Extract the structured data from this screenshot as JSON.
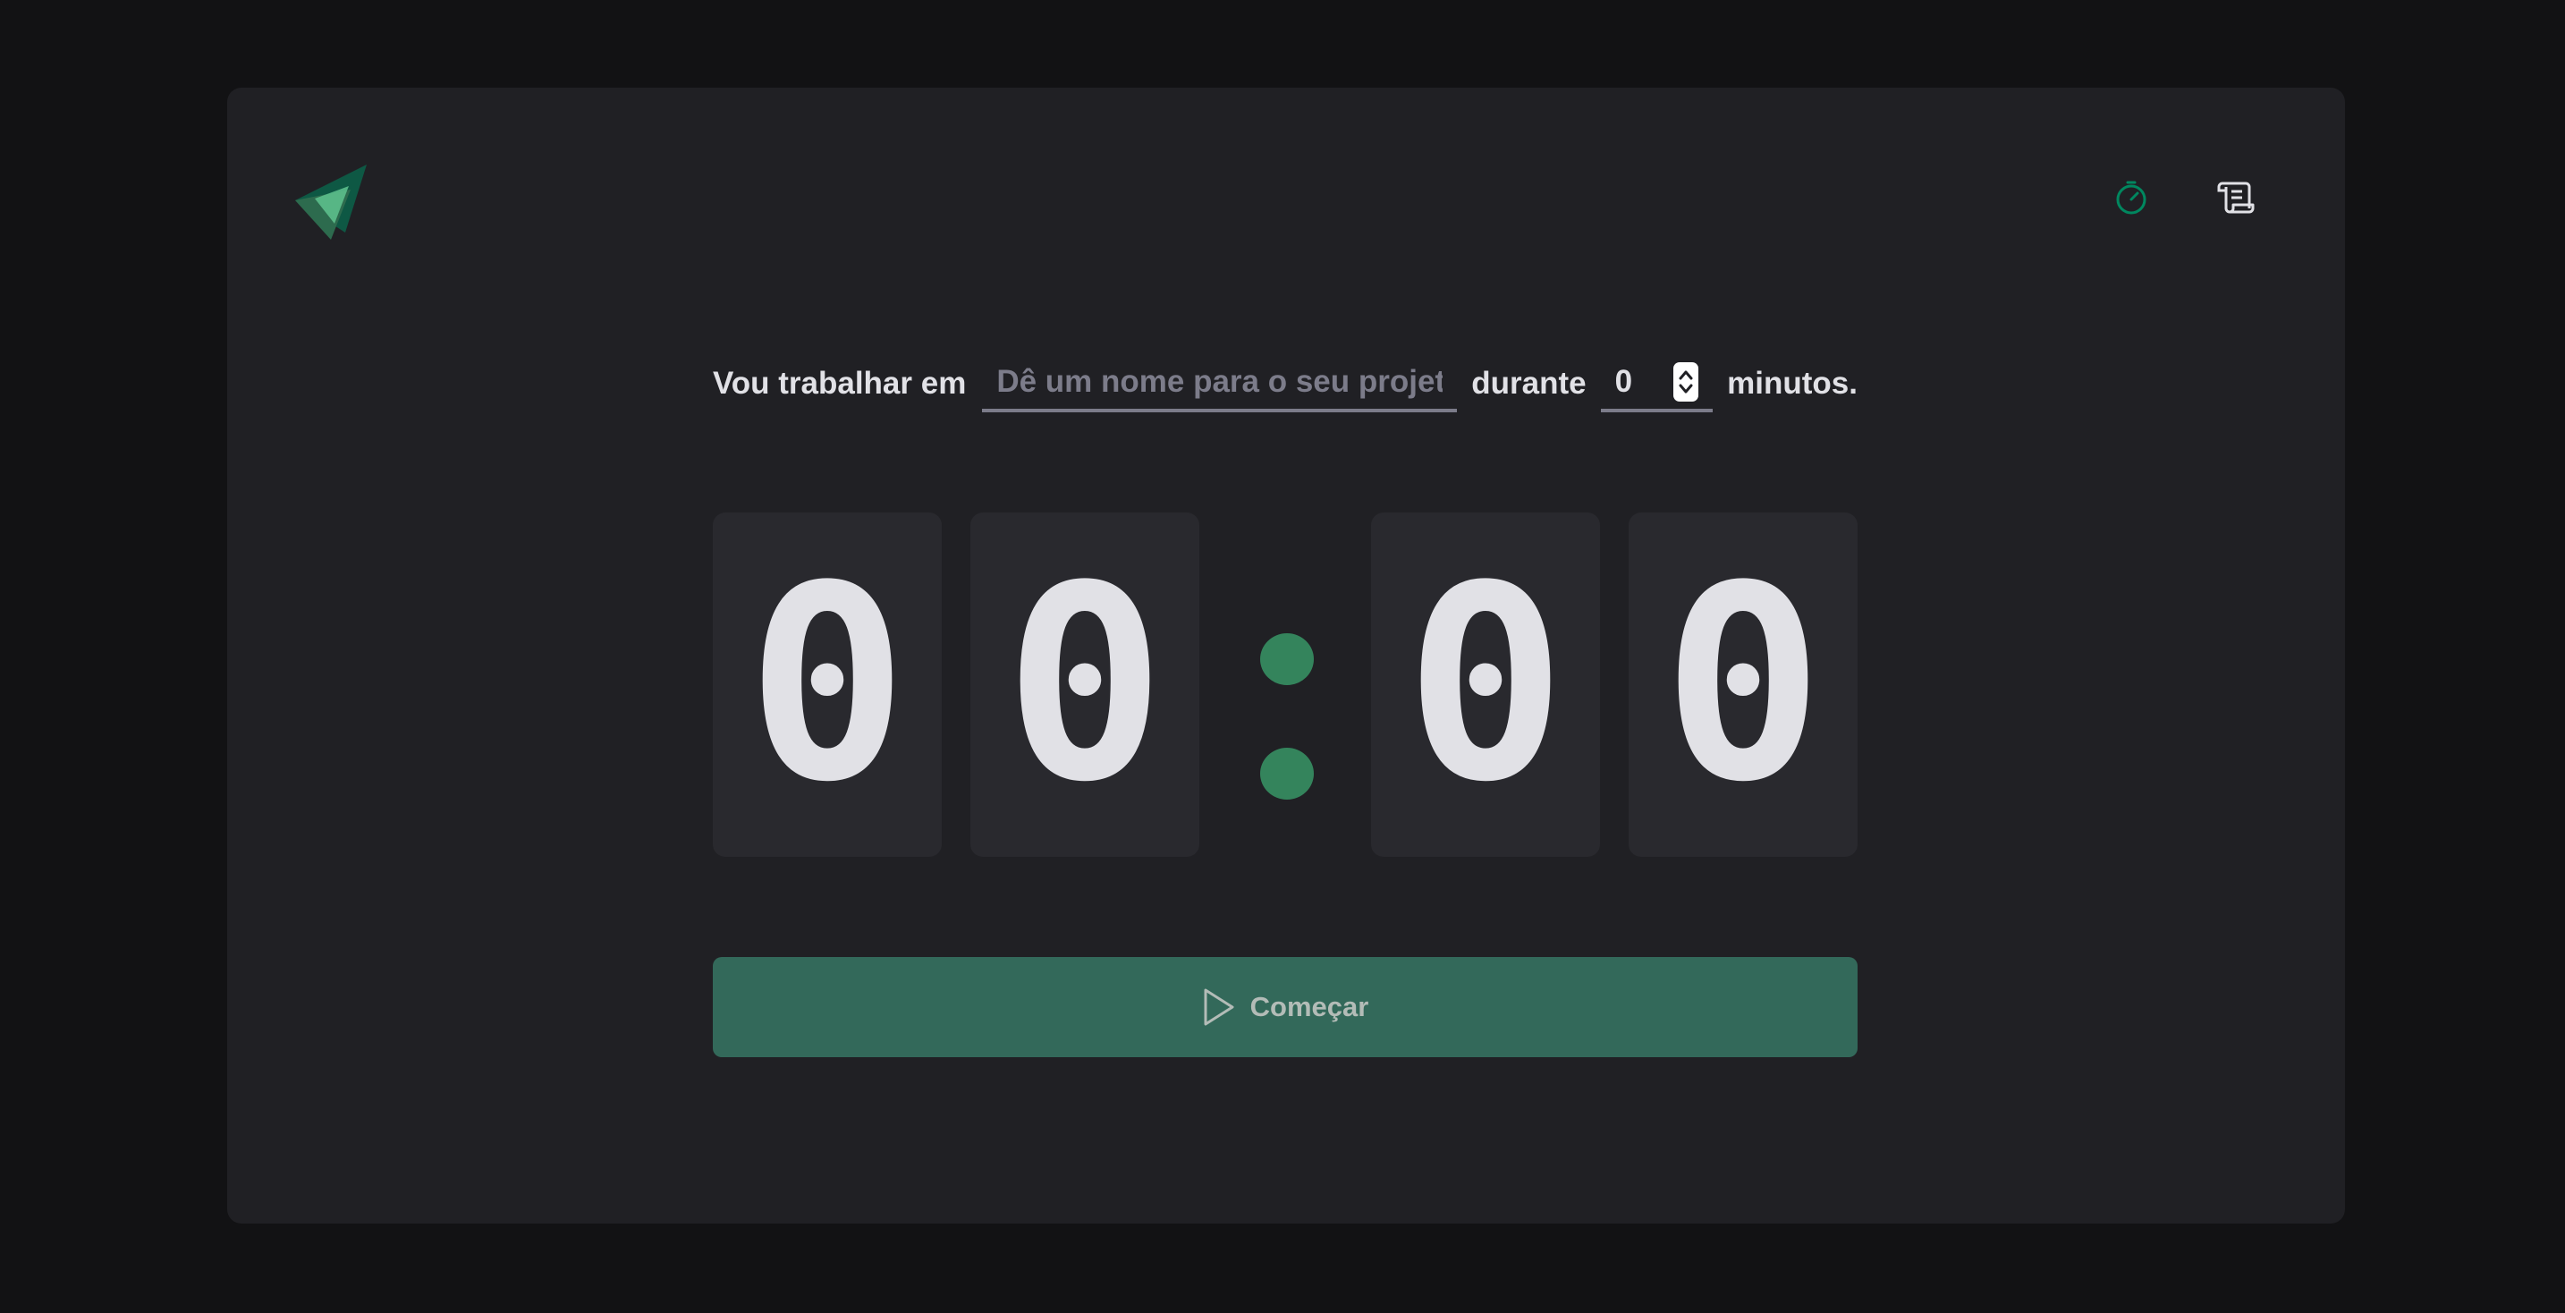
{
  "app": {
    "logo_icon": "paper-plane-logo-icon",
    "nav": [
      {
        "icon": "timer-icon",
        "active": true
      },
      {
        "icon": "scroll-history-icon",
        "active": false
      }
    ]
  },
  "form": {
    "prefix_label": "Vou trabalhar em",
    "task_placeholder": "Dê um nome para o seu projeto",
    "task_value": "",
    "middle_label": "durante",
    "minutes_value": "0",
    "suffix_label": "minutos."
  },
  "countdown": {
    "minute_tens": "0",
    "minute_ones": "0",
    "separator": ":",
    "second_tens": "0",
    "second_ones": "0"
  },
  "start_button": {
    "label": "Começar",
    "icon": "play-icon",
    "disabled": true
  },
  "colors": {
    "background": "#121214",
    "card": "#202024",
    "digit_box": "#29292e",
    "accent": "#00875f",
    "separator": "#34845c",
    "button": "#33695a",
    "text": "#e1e1e6",
    "muted": "#7c7c8a"
  }
}
